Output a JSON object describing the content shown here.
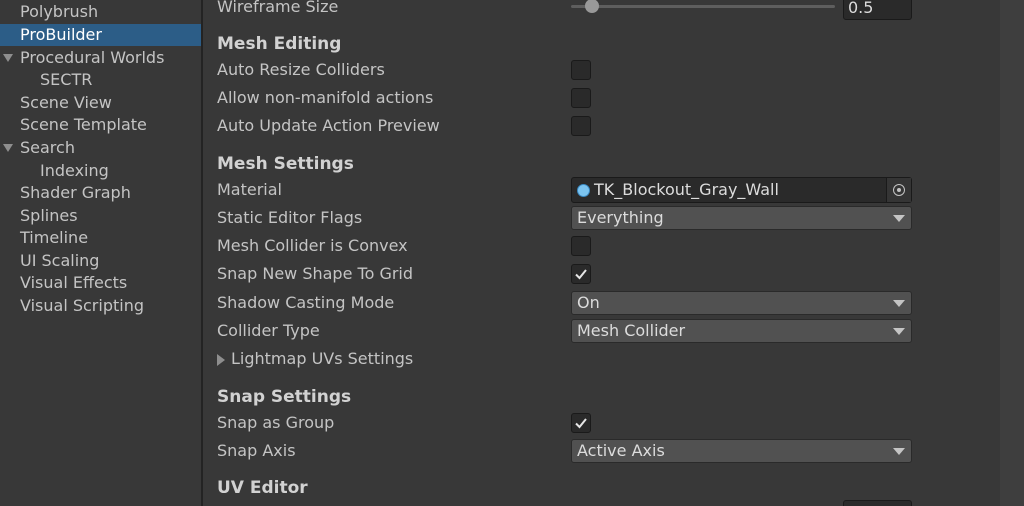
{
  "sidebar": {
    "items": [
      {
        "label": "Polybrush"
      },
      {
        "label": "ProBuilder"
      },
      {
        "label": "Procedural Worlds"
      },
      {
        "label": "SECTR"
      },
      {
        "label": "Scene View"
      },
      {
        "label": "Scene Template"
      },
      {
        "label": "Search"
      },
      {
        "label": "Indexing"
      },
      {
        "label": "Shader Graph"
      },
      {
        "label": "Splines"
      },
      {
        "label": "Timeline"
      },
      {
        "label": "UI Scaling"
      },
      {
        "label": "Visual Effects"
      },
      {
        "label": "Visual Scripting"
      }
    ],
    "selected": "ProBuilder"
  },
  "wireframe": {
    "label": "Wireframe Size",
    "value": "0.5",
    "slider_fraction": 0.08
  },
  "mesh_editing": {
    "header": "Mesh Editing",
    "auto_resize_colliders": {
      "label": "Auto Resize Colliders",
      "checked": false
    },
    "allow_non_manifold": {
      "label": "Allow non-manifold actions",
      "checked": false
    },
    "auto_update_preview": {
      "label": "Auto Update Action Preview",
      "checked": false
    }
  },
  "mesh_settings": {
    "header": "Mesh Settings",
    "material": {
      "label": "Material",
      "value": "TK_Blockout_Gray_Wall"
    },
    "static_editor_flags": {
      "label": "Static Editor Flags",
      "value": "Everything"
    },
    "mesh_collider_convex": {
      "label": "Mesh Collider is Convex",
      "checked": false
    },
    "snap_new_shape": {
      "label": "Snap New Shape To Grid",
      "checked": true
    },
    "shadow_casting_mode": {
      "label": "Shadow Casting Mode",
      "value": "On"
    },
    "collider_type": {
      "label": "Collider Type",
      "value": "Mesh Collider"
    },
    "lightmap_uvs": {
      "label": "Lightmap UVs Settings"
    }
  },
  "snap_settings": {
    "header": "Snap Settings",
    "snap_as_group": {
      "label": "Snap as Group",
      "checked": true
    },
    "snap_axis": {
      "label": "Snap Axis",
      "value": "Active Axis"
    }
  },
  "uv_editor": {
    "header": "UV Editor"
  },
  "colors": {
    "background": "#383838",
    "selected": "#2c5d87",
    "field": "#2a2a2a",
    "dropdown": "#515151",
    "object_icon": "#7cc4f0"
  }
}
